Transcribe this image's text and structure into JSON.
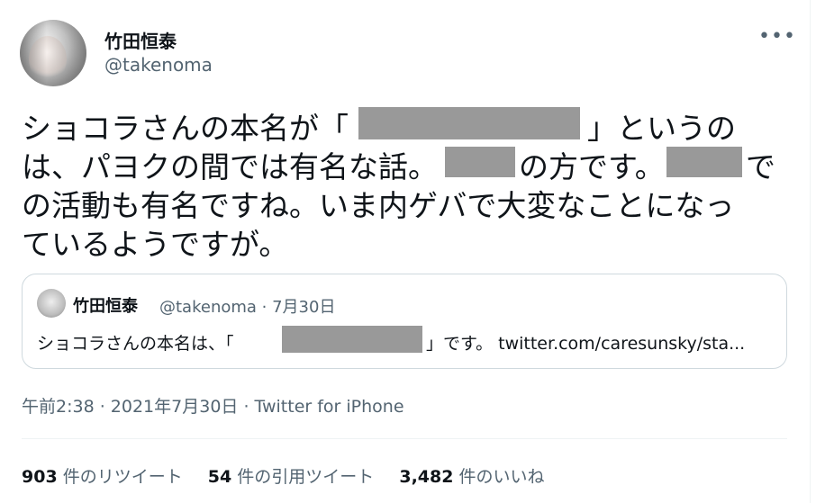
{
  "author": {
    "display_name": "竹田恒泰",
    "handle": "@takenoma"
  },
  "tweet": {
    "lines": [
      "ショコラさんの本名が「",
      "」というの",
      "は、パヨクの間では有名な話。",
      "の方です。",
      "で",
      "の活動も有名ですね。いま内ゲバで大変なことになっ",
      "ているようですが。"
    ],
    "timestamp": "午前2:38 · 2021年7月30日 · Twitter for iPhone"
  },
  "quoted": {
    "display_name": "竹田恒泰",
    "meta": "@takenoma · 7月30日",
    "text_prefix": "ショコラさんの本名は、「",
    "text_suffix": "」です。 twitter.com/caresunsky/sta..."
  },
  "stats": {
    "retweets_count": "903",
    "retweets_label": "件のリツイート",
    "quotes_count": "54",
    "quotes_label": "件の引用ツイート",
    "likes_count": "3,482",
    "likes_label": "件のいいね"
  },
  "icons": {
    "more": "more-options-icon"
  },
  "colors": {
    "text": "#0f1419",
    "secondary": "#536471",
    "redaction": "#999999",
    "border": "#cfd9de"
  }
}
